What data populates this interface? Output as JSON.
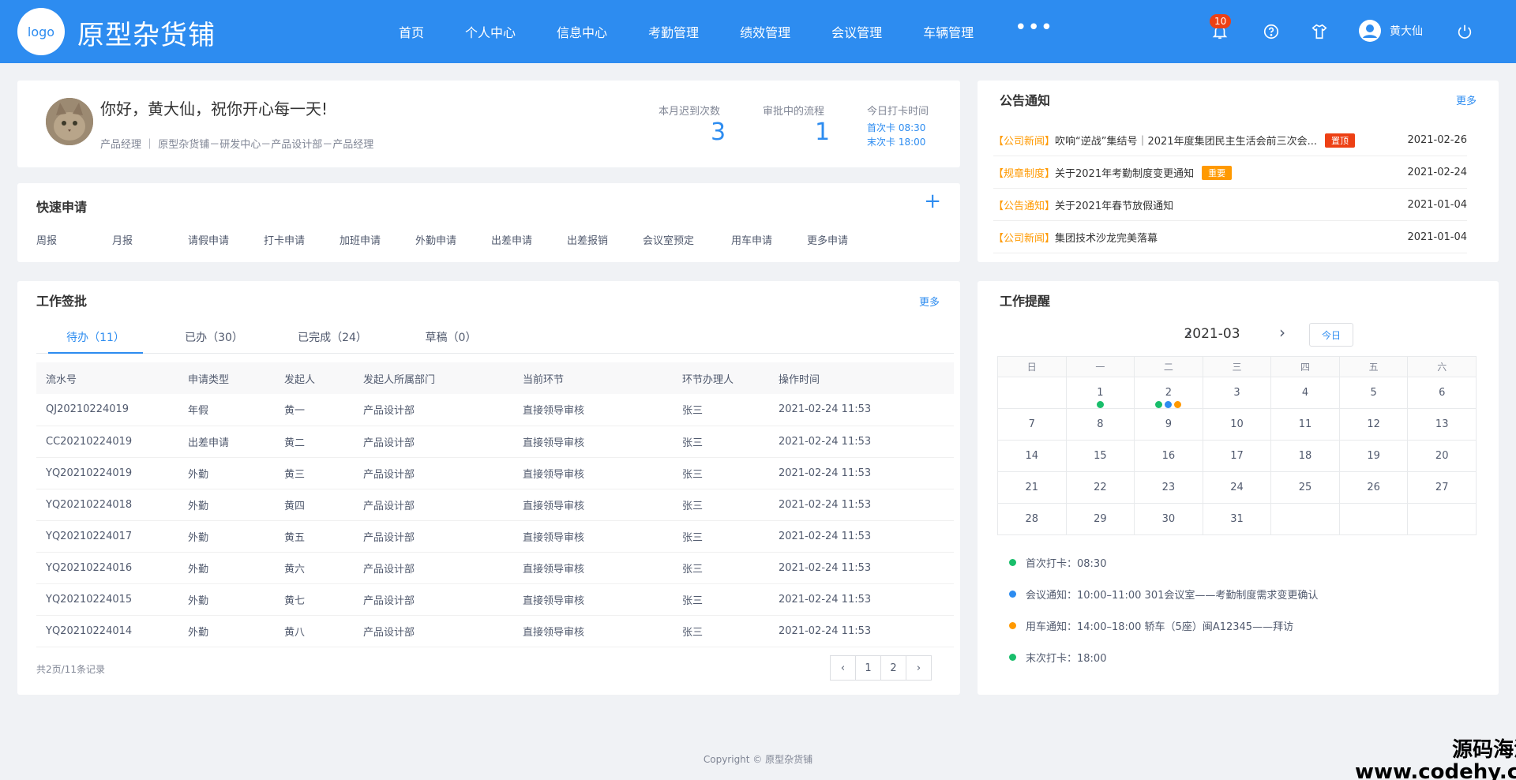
{
  "header": {
    "logo": "logo",
    "brand": "原型杂货铺",
    "nav": [
      "首页",
      "个人中心",
      "信息中心",
      "考勤管理",
      "绩效管理",
      "会议管理",
      "车辆管理"
    ],
    "more": "•••",
    "notification_count": "10",
    "username": "黄大仙"
  },
  "profile": {
    "greeting": "你好，黄大仙，祝你开心每一天!",
    "subinfo": "产品经理 ｜ 原型杂货铺－研发中心－产品设计部－产品经理",
    "stats": {
      "late_label": "本月迟到次数",
      "late_value": "3",
      "flow_label": "审批中的流程",
      "flow_value": "1",
      "punch_label": "今日打卡时间",
      "first_punch": "首次卡 08:30",
      "last_punch": "末次卡 18:00"
    }
  },
  "quick": {
    "title": "快速申请",
    "plus": "+",
    "items": [
      "周报",
      "月报",
      "请假申请",
      "打卡申请",
      "加班申请",
      "外勤申请",
      "出差申请",
      "出差报销",
      "会议室预定",
      "用车申请",
      "更多申请"
    ]
  },
  "announcements": {
    "title": "公告通知",
    "more": "更多",
    "items": [
      {
        "category": "【公司新闻】",
        "text": "吹响“逆战”集结号｜2021年度集团民主生活会前三次会...",
        "tag": "置顶",
        "tag_color": "#ed4014",
        "date": "2021-02-26"
      },
      {
        "category": "【规章制度】",
        "text": "关于2021年考勤制度变更通知",
        "tag": "重要",
        "tag_color": "#ff9900",
        "date": "2021-02-24"
      },
      {
        "category": "【公告通知】",
        "text": "关于2021年春节放假通知",
        "tag": "",
        "tag_color": "",
        "date": "2021-01-04"
      },
      {
        "category": "【公司新闻】",
        "text": "集团技术沙龙完美落幕",
        "tag": "",
        "tag_color": "",
        "date": "2021-01-04"
      }
    ]
  },
  "approval": {
    "title": "工作签批",
    "more": "更多",
    "tabs": [
      "待办（11）",
      "已办（30）",
      "已完成（24）",
      "草稿（0）"
    ],
    "columns": [
      "流水号",
      "申请类型",
      "发起人",
      "发起人所属部门",
      "当前环节",
      "环节办理人",
      "操作时间"
    ],
    "rows": [
      [
        "QJ20210224019",
        "年假",
        "黄一",
        "产品设计部",
        "直接领导审核",
        "张三",
        "2021-02-24 11:53"
      ],
      [
        "CC20210224019",
        "出差申请",
        "黄二",
        "产品设计部",
        "直接领导审核",
        "张三",
        "2021-02-24 11:53"
      ],
      [
        "YQ20210224019",
        "外勤",
        "黄三",
        "产品设计部",
        "直接领导审核",
        "张三",
        "2021-02-24 11:53"
      ],
      [
        "YQ20210224018",
        "外勤",
        "黄四",
        "产品设计部",
        "直接领导审核",
        "张三",
        "2021-02-24 11:53"
      ],
      [
        "YQ20210224017",
        "外勤",
        "黄五",
        "产品设计部",
        "直接领导审核",
        "张三",
        "2021-02-24 11:53"
      ],
      [
        "YQ20210224016",
        "外勤",
        "黄六",
        "产品设计部",
        "直接领导审核",
        "张三",
        "2021-02-24 11:53"
      ],
      [
        "YQ20210224015",
        "外勤",
        "黄七",
        "产品设计部",
        "直接领导审核",
        "张三",
        "2021-02-24 11:53"
      ],
      [
        "YQ20210224014",
        "外勤",
        "黄八",
        "产品设计部",
        "直接领导审核",
        "张三",
        "2021-02-24 11:53"
      ]
    ],
    "total": "共2页/11条记录",
    "pages": [
      "1",
      "2"
    ]
  },
  "reminder": {
    "title": "工作提醒",
    "month": "2021-03",
    "today": "今日",
    "weekdays": [
      "日",
      "一",
      "二",
      "三",
      "四",
      "五",
      "六"
    ],
    "first_weekday_offset": 1,
    "days_in_month": 31,
    "dots": {
      "1": [
        "#19be6b"
      ],
      "2": [
        "#19be6b",
        "#2d8cf0",
        "#ff9900"
      ]
    },
    "items": [
      {
        "color": "#19be6b",
        "text": "首次打卡：08:30"
      },
      {
        "color": "#2d8cf0",
        "text": "会议通知：10:00–11:00   301会议室——考勤制度需求变更确认"
      },
      {
        "color": "#ff9900",
        "text": "用车通知：14:00–18:00   轿车（5座）闽A12345——拜访"
      },
      {
        "color": "#19be6b",
        "text": "末次打卡：18:00"
      }
    ]
  },
  "footer": "Copyright © 原型杂货铺",
  "watermark": {
    "line1": "源码海洋网",
    "line2": "www.codehy.com"
  }
}
